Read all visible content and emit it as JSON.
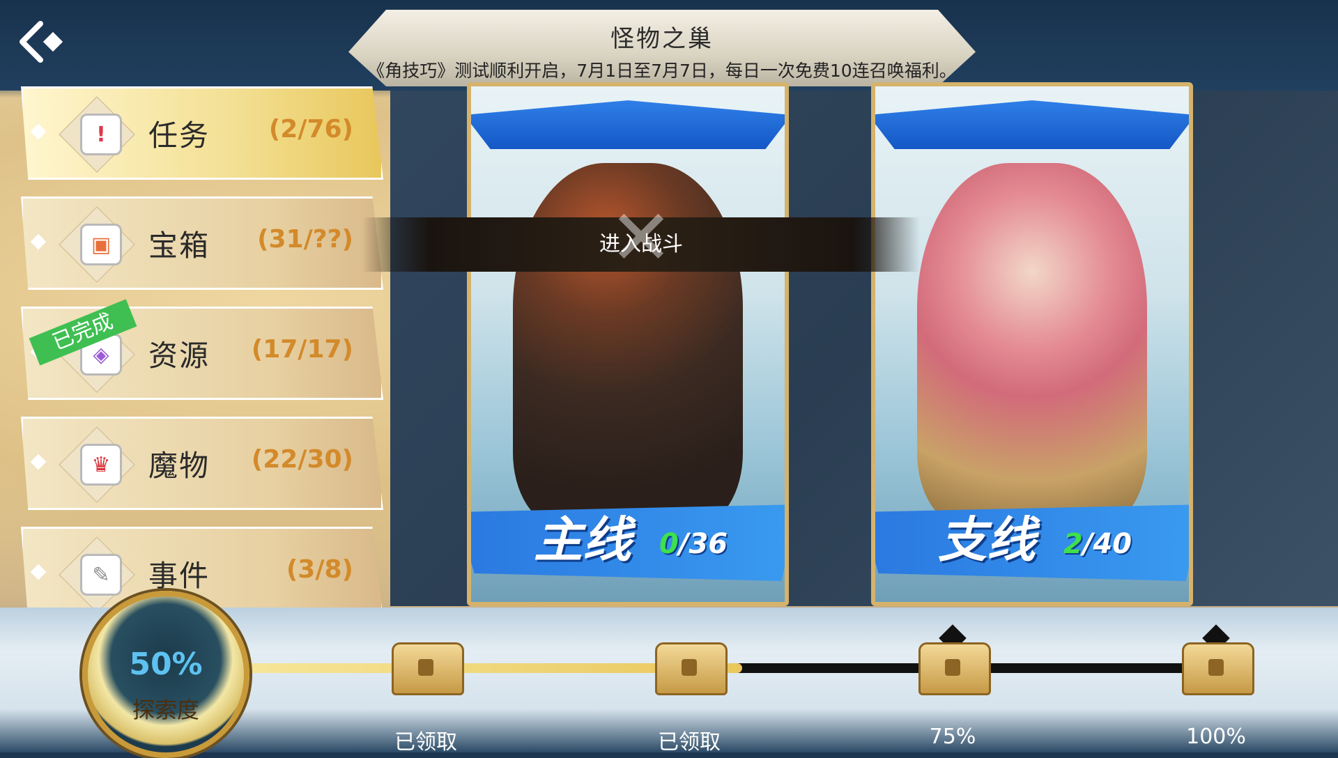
{
  "header": {
    "title": "怪物之巢",
    "ticker": "《角技巧》测试顺利开启，7月1日至7月7日，每日一次免费10连召唤福利。"
  },
  "menu": {
    "items": [
      {
        "label": "任务",
        "count": "(2/76)",
        "icon": "quest-exclamation-icon",
        "color": "#e0384a"
      },
      {
        "label": "宝箱",
        "count": "(31/??)",
        "icon": "treasure-chest-icon",
        "color": "#e8703a"
      },
      {
        "label": "资源",
        "count": "(17/17)",
        "icon": "resource-crystal-icon",
        "color": "#9b5ad6"
      },
      {
        "label": "魔物",
        "count": "(22/30)",
        "icon": "monster-face-icon",
        "color": "#d8323a"
      },
      {
        "label": "事件",
        "count": "(3/8)",
        "icon": "event-scroll-icon",
        "color": "#8a8a8a"
      }
    ],
    "completed_tag": "已完成"
  },
  "battle": {
    "label": "进入战斗"
  },
  "cards": [
    {
      "name": "主线",
      "current": "0",
      "total": "/36"
    },
    {
      "name": "支线",
      "current": "2",
      "total": "/40"
    }
  ],
  "exploration": {
    "percent_text": "50%",
    "label": "探索度",
    "progress": 0.5
  },
  "rewards": [
    {
      "label": "已领取",
      "state": "claimed"
    },
    {
      "label": "已领取",
      "state": "claimed"
    },
    {
      "label": "75%",
      "state": "locked"
    },
    {
      "label": "100%",
      "state": "locked"
    }
  ],
  "colors": {
    "accent": "#d38a2a",
    "progress_green": "#3fe04c",
    "ribbon_blue": "#2f7fe8"
  }
}
